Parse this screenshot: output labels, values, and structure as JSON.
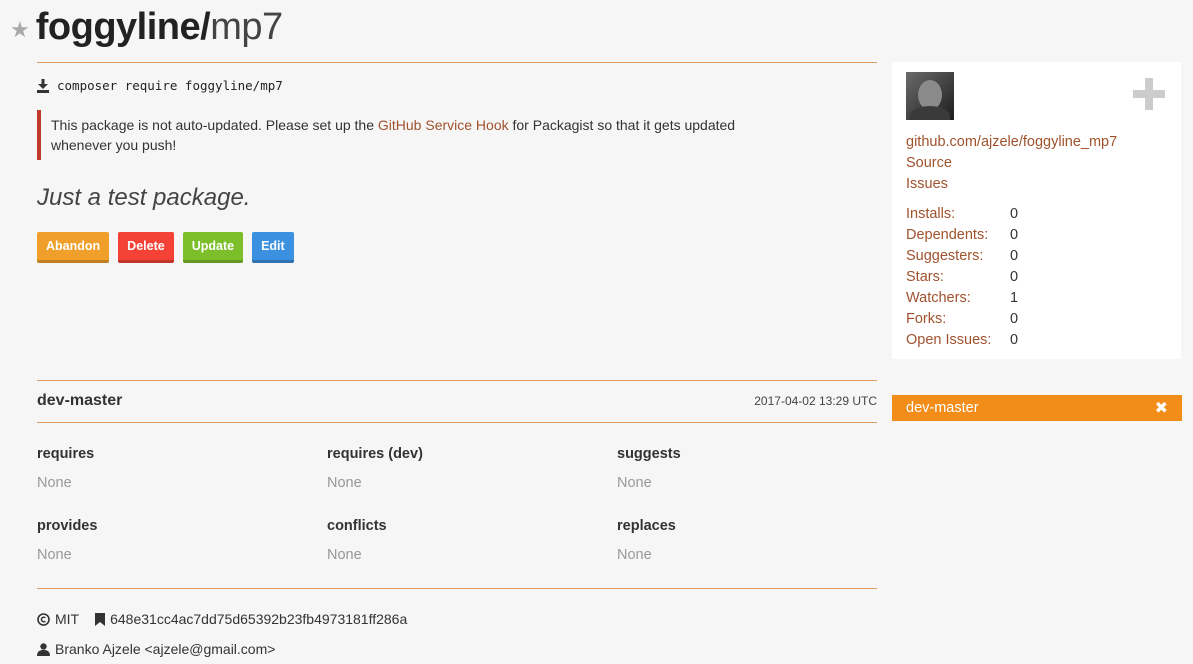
{
  "header": {
    "vendor": "foggyline/",
    "package": "mp7"
  },
  "install": {
    "command": "composer require foggyline/mp7"
  },
  "alert": {
    "text_before": "This package is not auto-updated. Please set up the ",
    "link": "GitHub Service Hook",
    "text_after": " for Packagist so that it gets updated whenever you push!"
  },
  "description": "Just a test package.",
  "buttons": [
    {
      "label": "Abandon",
      "color": "#f0a02a"
    },
    {
      "label": "Delete",
      "color": "#f44336"
    },
    {
      "label": "Update",
      "color": "#7cbf2a"
    },
    {
      "label": "Edit",
      "color": "#3b90e0"
    }
  ],
  "version": {
    "name": "dev-master",
    "date": "2017-04-02 13:29 UTC",
    "requires": {
      "label": "requires",
      "value": "None"
    },
    "requires_dev": {
      "label": "requires (dev)",
      "value": "None"
    },
    "suggests": {
      "label": "suggests",
      "value": "None"
    },
    "provides": {
      "label": "provides",
      "value": "None"
    },
    "conflicts": {
      "label": "conflicts",
      "value": "None"
    },
    "replaces": {
      "label": "replaces",
      "value": "None"
    },
    "license": "MIT",
    "commit": "648e31cc4ac7dd75d65392b23fb4973181ff286a",
    "author": "Branko Ajzele <ajzele@gmail.com>"
  },
  "sidebar": {
    "repo_link": "github.com/ajzele/foggyline_mp7",
    "source": "Source",
    "issues": "Issues",
    "stats": [
      {
        "label": "Installs:",
        "value": "0"
      },
      {
        "label": "Dependents:",
        "value": "0"
      },
      {
        "label": "Suggesters:",
        "value": "0"
      },
      {
        "label": "Stars:",
        "value": "0"
      },
      {
        "label": "Watchers:",
        "value": "1"
      },
      {
        "label": "Forks:",
        "value": "0"
      },
      {
        "label": "Open Issues:",
        "value": "0"
      }
    ],
    "version_bar": {
      "label": "dev-master",
      "close": "✖"
    }
  },
  "icons": {
    "star": "star-icon",
    "download": "download-icon",
    "plus": "plus-icon",
    "close": "close-icon",
    "license": "copyright-icon",
    "commit": "bookmark-icon",
    "author": "user-icon"
  },
  "colors": {
    "accent": "#f28d1a",
    "link": "#a0522d",
    "alert_border": "#c0392b",
    "divider": "#e0a060"
  }
}
